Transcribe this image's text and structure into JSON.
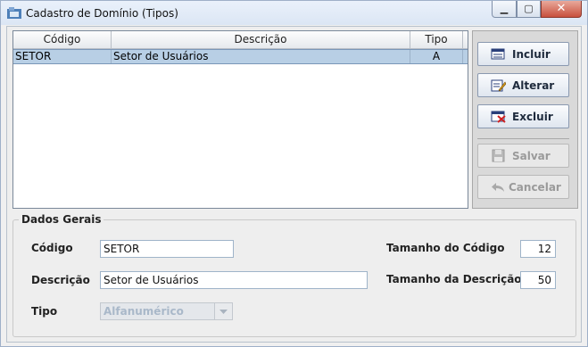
{
  "window": {
    "title": "Cadastro de Domínio (Tipos)"
  },
  "table": {
    "columns": [
      "Código",
      "Descrição",
      "Tipo"
    ],
    "rows": [
      {
        "codigo": "SETOR",
        "descricao": "Setor de Usuários",
        "tipo": "A"
      }
    ]
  },
  "actions": {
    "incluir": "Incluir",
    "alterar": "Alterar",
    "excluir": "Excluir",
    "salvar": "Salvar",
    "cancelar": "Cancelar"
  },
  "form": {
    "section": "Dados Gerais",
    "codigo_label": "Código",
    "codigo_value": "SETOR",
    "descricao_label": "Descrição",
    "descricao_value": "Setor de Usuários",
    "tipo_label": "Tipo",
    "tipo_value": "Alfanumérico",
    "tam_codigo_label": "Tamanho do Código",
    "tam_codigo_value": "12",
    "tam_descricao_label": "Tamanho da Descrição",
    "tam_descricao_value": "50"
  },
  "colors": {
    "selection": "#b8cfe5",
    "title_bar": "#dbe6f4",
    "close_button": "#c8503d"
  }
}
